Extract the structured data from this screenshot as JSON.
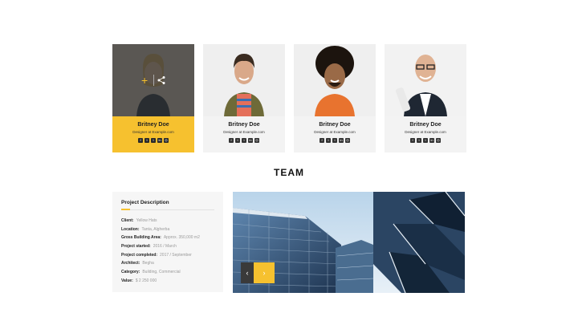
{
  "team": {
    "members": [
      {
        "name": "Britney Doe",
        "role": "Designer at Example.com"
      },
      {
        "name": "Britney Doe",
        "role": "Designer at Example.com"
      },
      {
        "name": "Britney Doe",
        "role": "Designer at Example.com"
      },
      {
        "name": "Britney Doe",
        "role": "Designer at Example.com"
      }
    ],
    "social_icons": [
      "facebook-icon",
      "twitter-icon",
      "tumblr-icon",
      "linkedin-icon",
      "dribbble-icon"
    ],
    "active_member": 1
  },
  "section": {
    "title": "TEAM"
  },
  "project": {
    "heading": "Project Description",
    "rows": [
      {
        "label": "Client:",
        "value": "Yellow Hats"
      },
      {
        "label": "Location:",
        "value": "Tanta, Algherba"
      },
      {
        "label": "Gross Building Area:",
        "value": "Approx. 350,000 m2"
      },
      {
        "label": "Project started:",
        "value": "2016 / March"
      },
      {
        "label": "Project completed:",
        "value": "2017 / September"
      },
      {
        "label": "Architect:",
        "value": "Begha"
      },
      {
        "label": "Category:",
        "value": "Building, Commercial"
      },
      {
        "label": "Value:",
        "value": "$ 2 250 000"
      }
    ]
  },
  "gallery": {
    "prev": "‹",
    "next": "›"
  },
  "colors": {
    "accent": "#f6c12f",
    "dark": "#333333",
    "panel": "#f6f6f6"
  }
}
